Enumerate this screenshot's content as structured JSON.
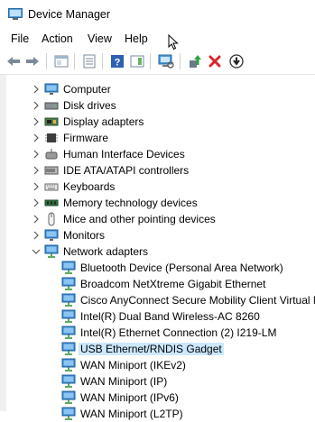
{
  "window": {
    "title": "Device Manager"
  },
  "menu": [
    {
      "label": "File"
    },
    {
      "label": "Action"
    },
    {
      "label": "View"
    },
    {
      "label": "Help"
    }
  ],
  "toolbar": [
    {
      "icon": "back-arrow-icon"
    },
    {
      "icon": "forward-arrow-icon"
    },
    {
      "icon": "properties-icon"
    },
    {
      "icon": "console-tree-icon"
    },
    {
      "icon": "help-icon"
    },
    {
      "icon": "action-pane-icon"
    },
    {
      "icon": "scan-hardware-icon"
    },
    {
      "icon": "update-driver-icon"
    },
    {
      "icon": "uninstall-device-icon"
    },
    {
      "icon": "disable-device-icon"
    }
  ],
  "tree": {
    "categories": [
      {
        "label": "Computer",
        "icon": "computer-icon"
      },
      {
        "label": "Disk drives",
        "icon": "disk-drive-icon"
      },
      {
        "label": "Display adapters",
        "icon": "display-adapter-icon"
      },
      {
        "label": "Firmware",
        "icon": "firmware-icon"
      },
      {
        "label": "Human Interface Devices",
        "icon": "hid-icon"
      },
      {
        "label": "IDE ATA/ATAPI controllers",
        "icon": "ide-controller-icon"
      },
      {
        "label": "Keyboards",
        "icon": "keyboard-icon"
      },
      {
        "label": "Memory technology devices",
        "icon": "memory-device-icon"
      },
      {
        "label": "Mice and other pointing devices",
        "icon": "mouse-icon"
      },
      {
        "label": "Monitors",
        "icon": "monitor-icon"
      },
      {
        "label": "Network adapters",
        "icon": "network-adapter-icon",
        "expanded": true
      }
    ],
    "network_adapters": [
      {
        "label": "Bluetooth Device (Personal Area Network)"
      },
      {
        "label": "Broadcom NetXtreme Gigabit Ethernet"
      },
      {
        "label": "Cisco AnyConnect Secure Mobility Client Virtual M"
      },
      {
        "label": "Intel(R) Dual Band Wireless-AC 8260"
      },
      {
        "label": "Intel(R) Ethernet Connection (2) I219-LM"
      },
      {
        "label": "USB Ethernet/RNDIS Gadget",
        "selected": true
      },
      {
        "label": "WAN Miniport (IKEv2)"
      },
      {
        "label": "WAN Miniport (IP)"
      },
      {
        "label": "WAN Miniport (IPv6)"
      },
      {
        "label": "WAN Miniport (L2TP)"
      }
    ]
  }
}
